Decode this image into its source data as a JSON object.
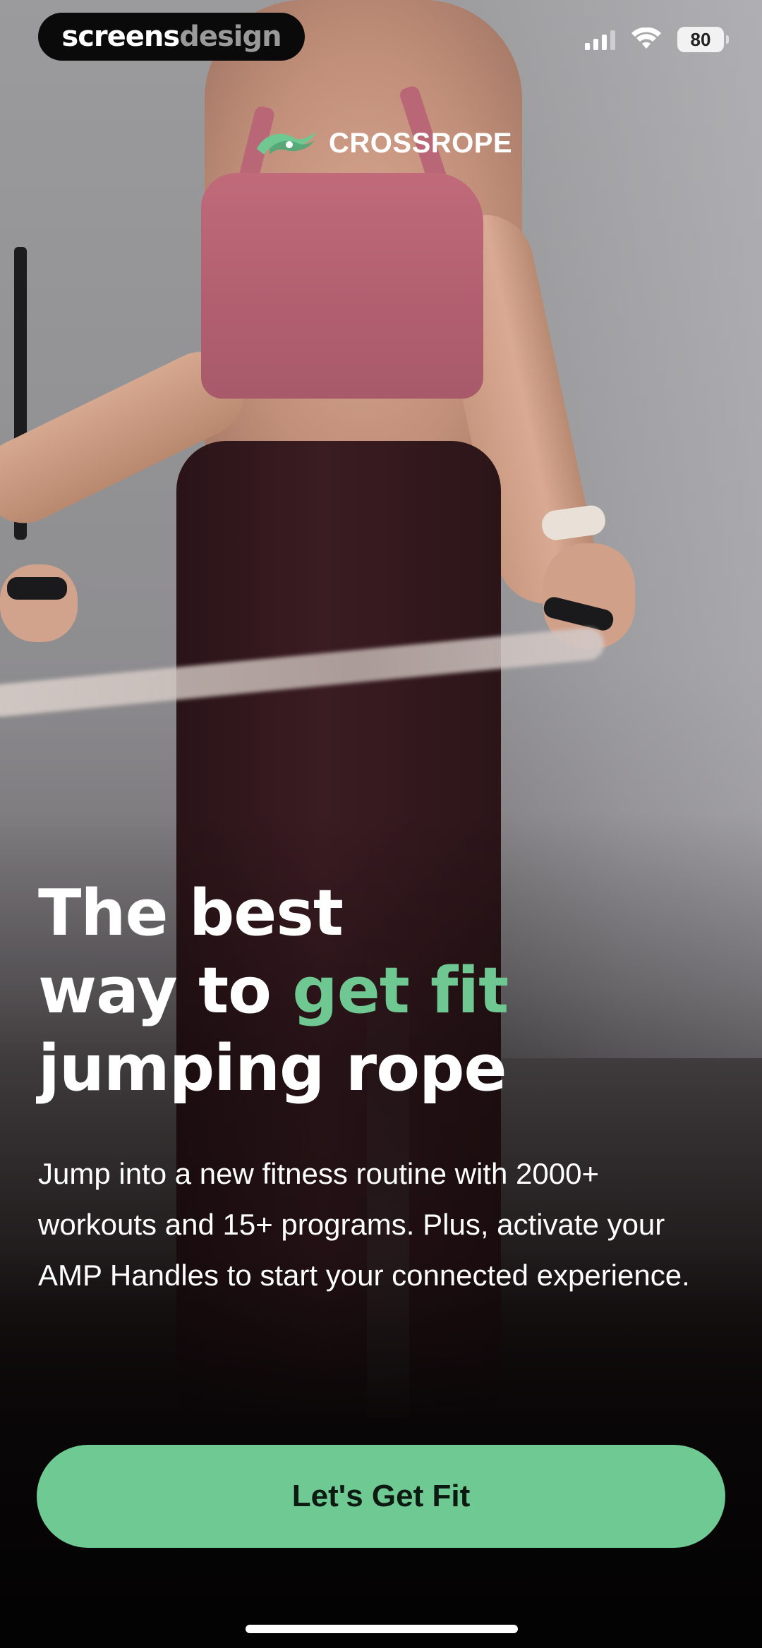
{
  "status_bar": {
    "badge_word_1": "screens",
    "badge_word_2": "design",
    "battery_level": "80",
    "signal_bars_active": 3,
    "signal_bars_total": 4
  },
  "brand": {
    "logo_text": "CROSSROPE",
    "accent_color": "#6fc891"
  },
  "hero": {
    "headline_line_1": "The best",
    "headline_line_2_prefix": "way to ",
    "headline_line_2_accent": "get fit",
    "headline_line_3": "jumping rope",
    "body": "Jump into a new fitness routine with 2000+ workouts and 15+ programs. Plus, activate your AMP Handles to start your connected experience."
  },
  "cta": {
    "label": "Let's Get Fit",
    "color": "#6fc992"
  },
  "icons": {
    "signal": "cellular-signal-icon",
    "wifi": "wifi-icon",
    "battery": "battery-icon",
    "logo_mark": "crossrope-swoosh-icon"
  }
}
